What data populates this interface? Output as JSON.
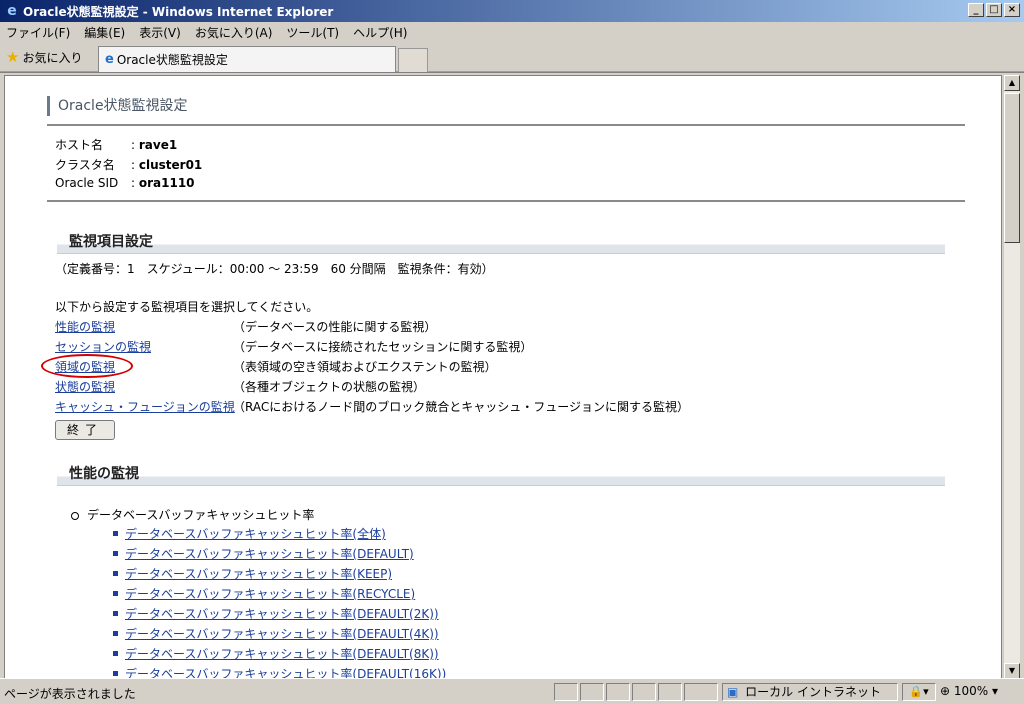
{
  "window": {
    "title": "Oracle状態監視設定 - Windows Internet Explorer"
  },
  "menu": [
    "ファイル(F)",
    "編集(E)",
    "表示(V)",
    "お気に入り(A)",
    "ツール(T)",
    "ヘルプ(H)"
  ],
  "favorites_label": "お気に入り",
  "tab_title": "Oracle状態監視設定",
  "page": {
    "title": "Oracle状態監視設定",
    "info": [
      {
        "key": "ホスト名",
        "value": "rave1"
      },
      {
        "key": "クラスタ名",
        "value": "cluster01"
      },
      {
        "key": "Oracle SID",
        "value": "ora1110"
      }
    ],
    "section1_title": "監視項目設定",
    "schedule": "（定義番号：1　スケジュール：00:00 ～ 23:59　60 分間隔　監視条件：有効）",
    "instruction": "以下から設定する監視項目を選択してください。",
    "monitor_items": [
      {
        "label": "性能の監視",
        "desc": "（データベースの性能に関する監視）"
      },
      {
        "label": "セッションの監視",
        "desc": "（データベースに接続されたセッションに関する監視）"
      },
      {
        "label": "領域の監視",
        "desc": "（表領域の空き領域およびエクステントの監視）"
      },
      {
        "label": "状態の監視",
        "desc": "（各種オブジェクトの状態の監視）"
      },
      {
        "label": "キャッシュ・フュージョンの監視",
        "desc": "（RACにおけるノード間のブロック競合とキャッシュ・フュージョンに関する監視）"
      }
    ],
    "end_button": "終了",
    "section2_title": "性能の監視",
    "perf_group": "データベースバッファキャッシュヒット率",
    "perf_links": [
      "データベースバッファキャッシュヒット率(全体)",
      "データベースバッファキャッシュヒット率(DEFAULT)",
      "データベースバッファキャッシュヒット率(KEEP)",
      "データベースバッファキャッシュヒット率(RECYCLE)",
      "データベースバッファキャッシュヒット率(DEFAULT(2K))",
      "データベースバッファキャッシュヒット率(DEFAULT(4K))",
      "データベースバッファキャッシュヒット率(DEFAULT(8K))",
      "データベースバッファキャッシュヒット率(DEFAULT(16K))"
    ]
  },
  "status": {
    "text": "ページが表示されました",
    "zone": "ローカル イントラネット",
    "zoom": "100%"
  }
}
